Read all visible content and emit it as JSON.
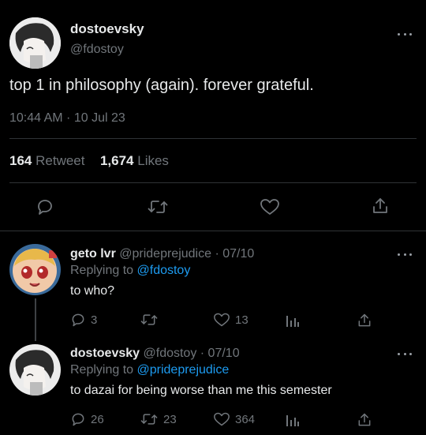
{
  "main_tweet": {
    "display_name": "dostoevsky",
    "handle": "@fdostoy",
    "text": "top 1 in philosophy (again). forever grateful.",
    "timestamp": "10:44 AM · 10 Jul 23",
    "retweets": "164",
    "retweets_label": "Retweet",
    "likes": "1,674",
    "likes_label": "Likes"
  },
  "replies": [
    {
      "display_name": "geto lvr",
      "handle": "@prideprejudice",
      "date": "· 07/10",
      "replying_prefix": "Replying to",
      "replying_to": "@fdostoy",
      "text": "to who?",
      "reply_count": "3",
      "retweet_count": "",
      "like_count": "13"
    },
    {
      "display_name": "dostoevsky",
      "handle": "@fdostoy",
      "date": "· 07/10",
      "replying_prefix": "Replying to",
      "replying_to": "@prideprejudice",
      "text": "to dazai for being worse than me this semester",
      "reply_count": "26",
      "retweet_count": "23",
      "like_count": "364"
    }
  ],
  "icons": [
    "more-icon",
    "reply-icon",
    "retweet-icon",
    "like-icon",
    "share-icon",
    "analytics-icon"
  ],
  "colors": {
    "background": "#000000",
    "text": "#e7e9ea",
    "muted": "#71767b",
    "link": "#1d9bf0",
    "divider": "#2f3336"
  }
}
